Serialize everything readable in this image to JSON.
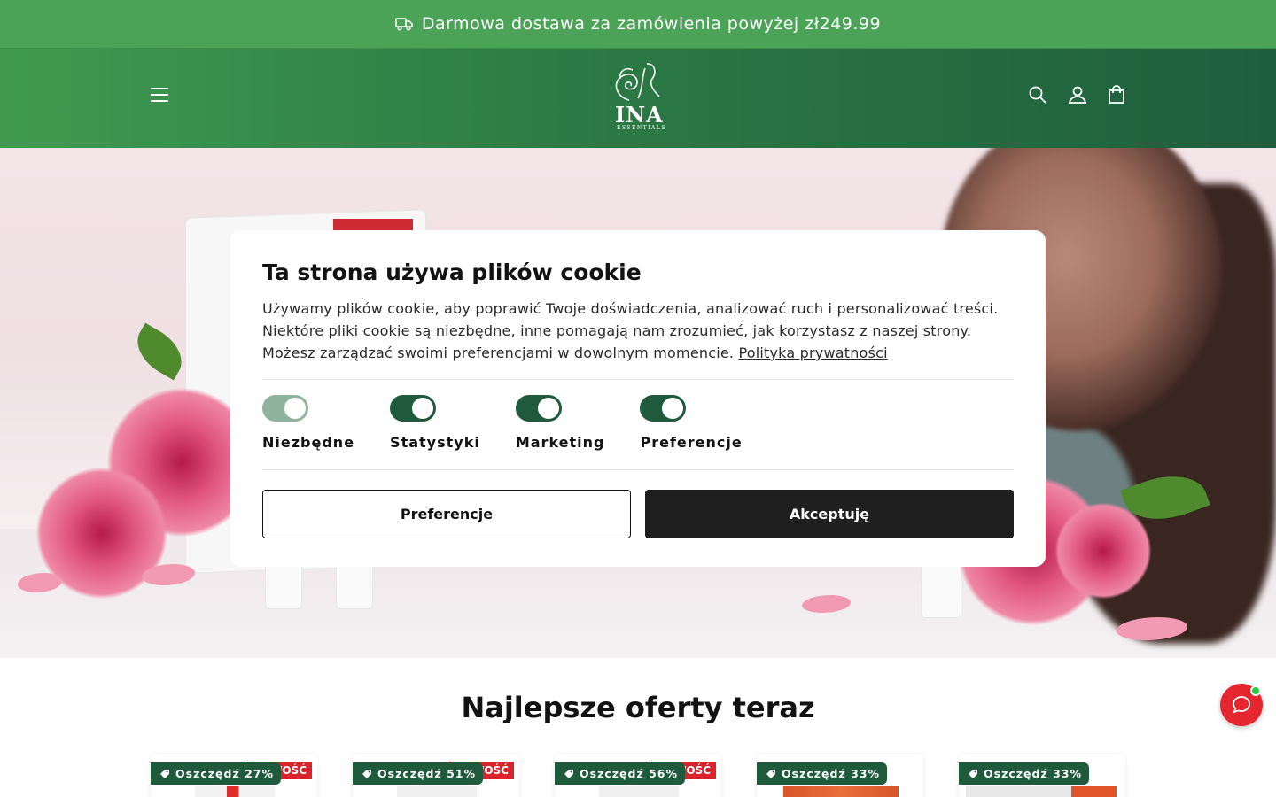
{
  "announcement": {
    "text": "Darmowa dostawa za zamówienia powyżej zł249.99",
    "icon": "truck-icon"
  },
  "header": {
    "logo_text": "INA",
    "logo_subtext": "ESSENTIALS",
    "icons": [
      "menu-icon",
      "search-icon",
      "account-icon",
      "cart-icon"
    ],
    "colors": {
      "bar_start": "#3f9b4f",
      "bar_end": "#1f5e3d"
    }
  },
  "cookie_modal": {
    "title": "Ta strona używa plików cookie",
    "body": "Używamy plików cookie, aby poprawić Twoje doświadczenia, analizować ruch i personalizować treści. Niektóre pliki cookie są niezbędne, inne pomagają nam zrozumieć, jak korzystasz z naszej strony. Możesz zarządzać swoimi preferencjami w dowolnym momencie.",
    "privacy_link": "Polityka prywatności",
    "toggles": [
      {
        "label": "Niezbędne",
        "on": true,
        "disabled": true
      },
      {
        "label": "Statystyki",
        "on": true,
        "disabled": false
      },
      {
        "label": "Marketing",
        "on": true,
        "disabled": false
      },
      {
        "label": "Preferencje",
        "on": true,
        "disabled": false
      }
    ],
    "preferences_button": "Preferencje",
    "accept_button": "Akceptuję",
    "accent_color": "#1e5a3b"
  },
  "section": {
    "title": "Najlepsze oferty teraz"
  },
  "products": [
    {
      "save_label": "Oszczędź 27%",
      "badge": "NOWOŚĆ"
    },
    {
      "save_label": "Oszczędź 51%",
      "badge": "NOWOŚĆ"
    },
    {
      "save_label": "Oszczędź 56%",
      "badge": "NOWOŚĆ"
    },
    {
      "save_label": "Oszczędź 33%",
      "badge": ""
    },
    {
      "save_label": "Oszczędź 33%",
      "badge": ""
    }
  ],
  "chat": {
    "icon": "chat-bubble-icon",
    "status": "online"
  }
}
